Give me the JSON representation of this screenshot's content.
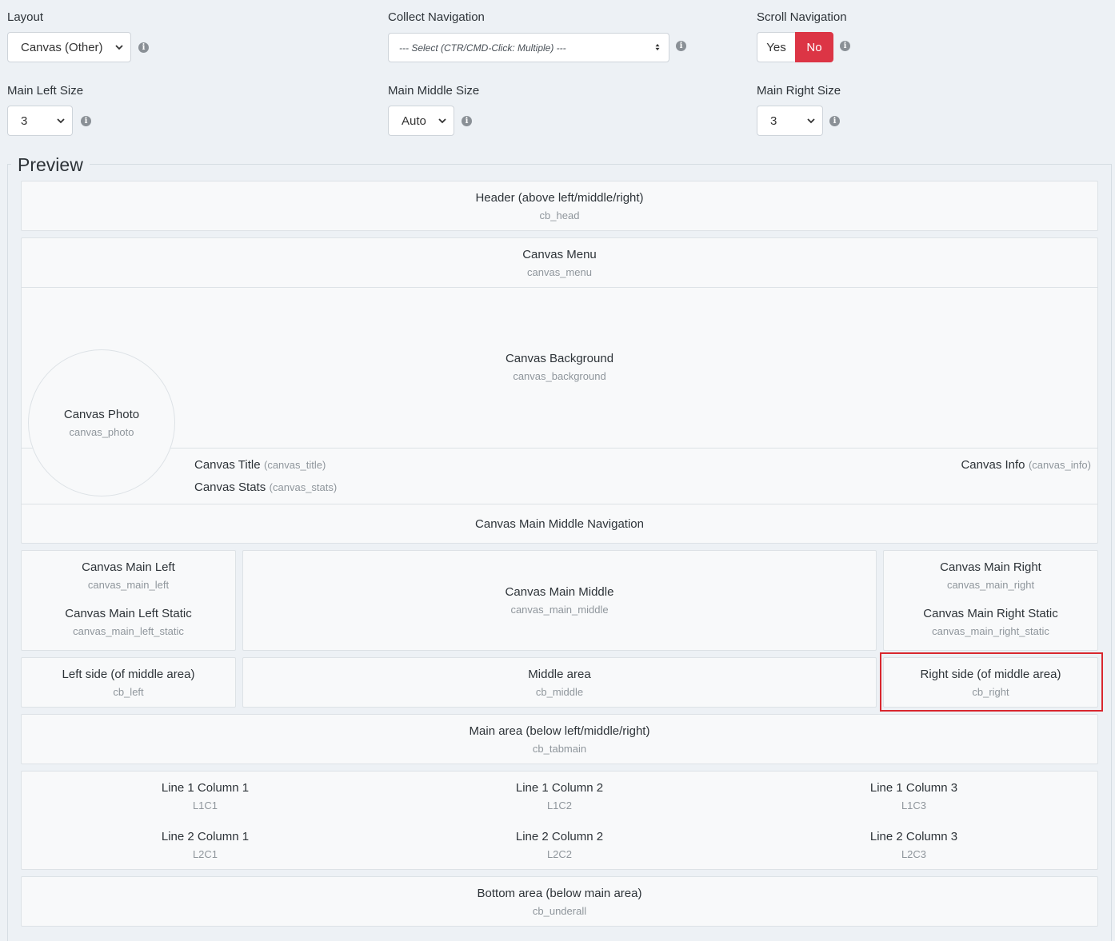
{
  "settings": {
    "layout": {
      "label": "Layout",
      "value": "Canvas (Other)"
    },
    "collect_nav": {
      "label": "Collect Navigation",
      "value": "--- Select (CTR/CMD-Click: Multiple) ---"
    },
    "scroll_nav": {
      "label": "Scroll Navigation",
      "yes": "Yes",
      "no": "No",
      "active": "No"
    },
    "main_left": {
      "label": "Main Left Size",
      "value": "3"
    },
    "main_middle": {
      "label": "Main Middle Size",
      "value": "Auto"
    },
    "main_right": {
      "label": "Main Right Size",
      "value": "3"
    },
    "info_glyph": "i"
  },
  "preview": {
    "legend": "Preview",
    "header": {
      "title": "Header (above left/middle/right)",
      "sub": "cb_head"
    },
    "menu": {
      "title": "Canvas Menu",
      "sub": "canvas_menu"
    },
    "background": {
      "title": "Canvas Background",
      "sub": "canvas_background"
    },
    "photo": {
      "title": "Canvas Photo",
      "sub": "canvas_photo"
    },
    "canvas_title": {
      "title": "Canvas Title",
      "sub": "(canvas_title)"
    },
    "canvas_stats": {
      "title": "Canvas Stats",
      "sub": "(canvas_stats)"
    },
    "canvas_info": {
      "title": "Canvas Info",
      "sub": "(canvas_info)"
    },
    "main_middle_nav": {
      "title": "Canvas Main Middle Navigation"
    },
    "main_left": {
      "title": "Canvas Main Left",
      "sub": "canvas_main_left",
      "static_title": "Canvas Main Left Static",
      "static_sub": "canvas_main_left_static"
    },
    "main_middle": {
      "title": "Canvas Main Middle",
      "sub": "canvas_main_middle"
    },
    "main_right": {
      "title": "Canvas Main Right",
      "sub": "canvas_main_right",
      "static_title": "Canvas Main Right Static",
      "static_sub": "canvas_main_right_static"
    },
    "left_side": {
      "title": "Left side (of middle area)",
      "sub": "cb_left"
    },
    "middle_area": {
      "title": "Middle area",
      "sub": "cb_middle"
    },
    "right_side": {
      "title": "Right side (of middle area)",
      "sub": "cb_right"
    },
    "main_area": {
      "title": "Main area (below left/middle/right)",
      "sub": "cb_tabmain"
    },
    "grid": [
      {
        "title": "Line 1 Column 1",
        "sub": "L1C1"
      },
      {
        "title": "Line 1 Column 2",
        "sub": "L1C2"
      },
      {
        "title": "Line 1 Column 3",
        "sub": "L1C3"
      },
      {
        "title": "Line 2 Column 1",
        "sub": "L2C1"
      },
      {
        "title": "Line 2 Column 2",
        "sub": "L2C2"
      },
      {
        "title": "Line 2 Column 3",
        "sub": "L2C3"
      }
    ],
    "bottom": {
      "title": "Bottom area (below main area)",
      "sub": "cb_underall"
    }
  },
  "colors": {
    "accent_no": "#dc3545",
    "highlight": "#d9272e"
  }
}
